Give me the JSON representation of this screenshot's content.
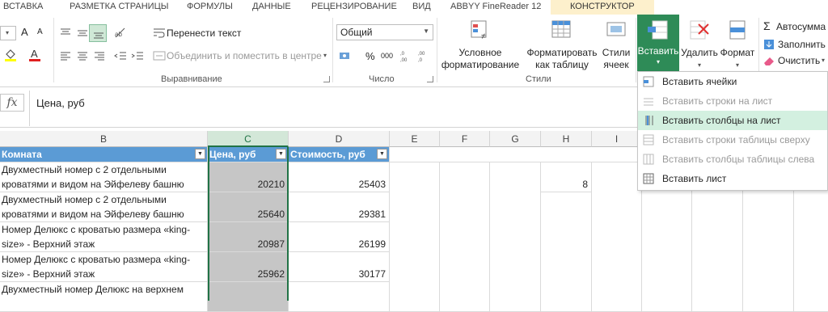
{
  "tabs": [
    "ВСТАВКА",
    "РАЗМЕТКА СТРАНИЦЫ",
    "ФОРМУЛЫ",
    "ДАННЫЕ",
    "РЕЦЕНЗИРОВАНИЕ",
    "ВИД",
    "ABBYY FineReader 12",
    "КОНСТРУКТОР"
  ],
  "ribbon": {
    "wrap_text": "Перенести текст",
    "merge_center": "Объединить и поместить в центре",
    "alignment_label": "Выравнивание",
    "number_format": "Общий",
    "number_label": "Число",
    "percent": "%",
    "thousands": "000",
    "cond_format": [
      "Условное",
      "форматирование"
    ],
    "format_table": [
      "Форматировать",
      "как таблицу"
    ],
    "cell_styles": [
      "Стили",
      "ячеек"
    ],
    "styles_label": "Стили",
    "insert": "Вставить",
    "delete": "Удалить",
    "format": "Формат",
    "autosum": "Автосумма",
    "fill": "Заполнить",
    "clear": "Очистить",
    "font_grow": "A",
    "font_shrink": "A"
  },
  "formula_bar": {
    "fx": "fx",
    "value": "Цена, руб"
  },
  "columns": [
    "B",
    "C",
    "D",
    "E",
    "F",
    "G",
    "H",
    "I"
  ],
  "table": {
    "headers": [
      "Комната",
      "Цена, руб",
      "Стоимость, руб"
    ],
    "rows": [
      {
        "line1": "Двухместный номер с 2 отдельными",
        "line2": "кроватями и видом на Эйфелеву башню",
        "price": "20210",
        "cost": "25403"
      },
      {
        "line1": "Двухместный номер с 2 отдельными",
        "line2": "кроватями и видом на Эйфелеву башню",
        "price": "25640",
        "cost": "29381"
      },
      {
        "line1": "Номер Делюкс с кроватью размера «king-",
        "line2": "size» - Верхний этаж",
        "price": "20987",
        "cost": "26199"
      },
      {
        "line1": "Номер Делюкс с кроватью размера «king-",
        "line2": "size» - Верхний этаж",
        "price": "25962",
        "cost": "30177"
      },
      {
        "line1": "Двухместный номер Делюкс на верхнем",
        "line2": "",
        "price": "",
        "cost": ""
      }
    ],
    "h_value": "8"
  },
  "insert_menu": [
    {
      "label": "Вставить ячейки",
      "enabled": true
    },
    {
      "label": "Вставить строки на лист",
      "enabled": false
    },
    {
      "label": "Вставить столбцы на лист",
      "enabled": true,
      "highlighted": true
    },
    {
      "label": "Вставить строки таблицы сверху",
      "enabled": false
    },
    {
      "label": "Вставить столбцы таблицы слева",
      "enabled": false
    },
    {
      "label": "Вставить лист",
      "enabled": true
    }
  ],
  "colors": {
    "accent": "#217346",
    "table_header": "#5b9bd5",
    "selection": "#c6c6c6"
  }
}
